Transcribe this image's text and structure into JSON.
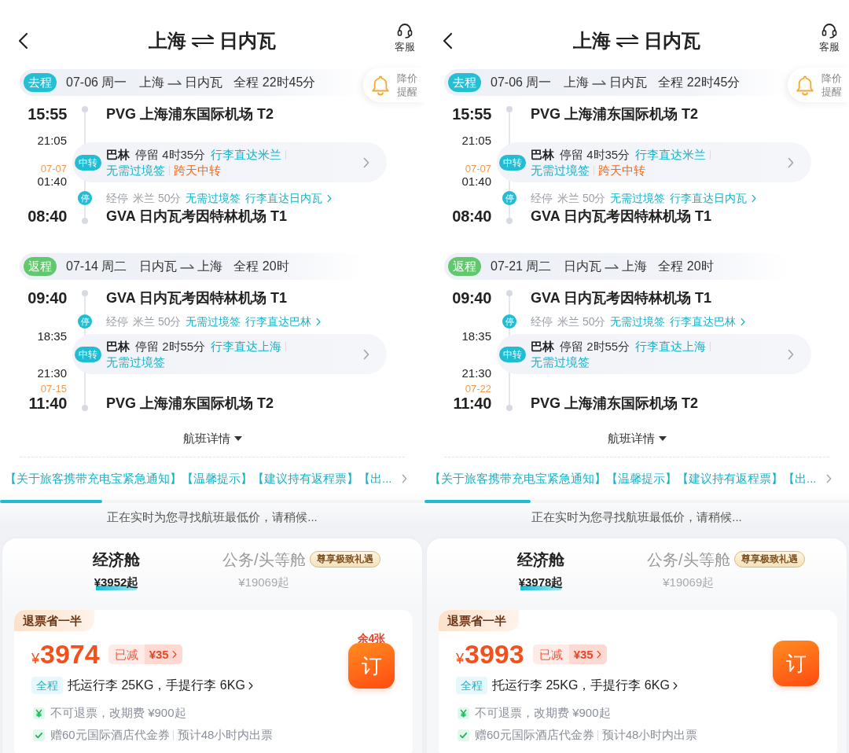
{
  "panels": [
    {
      "header": {
        "origin": "上海",
        "destination": "日内瓦",
        "service_label": "客服"
      },
      "legs": [
        {
          "kind": "outbound",
          "tag": "去程",
          "date": "07-06 周一",
          "from": "上海",
          "to": "日内瓦",
          "duration": "全程 22时45分",
          "price_alert": {
            "label": "降价提醒"
          },
          "stops": [
            {
              "kind": "airport",
              "time": "15:55",
              "airport": "PVG 上海浦东国际机场 T2"
            },
            {
              "kind": "transfer",
              "arrive": "21:05",
              "depart_date": "07-07",
              "depart": "01:40",
              "tag": "中转",
              "city": "巴林",
              "stay": "停留 4时35分",
              "notes": [
                {
                  "kind": "info",
                  "text": "行李直达米兰"
                },
                {
                  "kind": "info",
                  "text": "无需过境签"
                },
                {
                  "kind": "warning",
                  "text": "跨天中转"
                }
              ]
            },
            {
              "kind": "stopover",
              "tag": "停",
              "label": "经停",
              "detail": "米兰 50分",
              "notes": [
                "无需过境签",
                "行李直达日内瓦"
              ]
            },
            {
              "kind": "airport",
              "time": "08:40",
              "airport": "GVA 日内瓦考因特林机场 T1"
            }
          ]
        },
        {
          "kind": "return",
          "tag": "返程",
          "date": "07-14 周二",
          "from": "日内瓦",
          "to": "上海",
          "duration": "全程 20时",
          "stops": [
            {
              "kind": "airport",
              "time": "09:40",
              "airport": "GVA 日内瓦考因特林机场 T1"
            },
            {
              "kind": "stopover",
              "tag": "停",
              "label": "经停",
              "detail": "米兰 50分",
              "notes": [
                "无需过境签",
                "行李直达巴林"
              ]
            },
            {
              "kind": "transfer",
              "arrive": "18:35",
              "depart": "21:30",
              "tag": "中转",
              "city": "巴林",
              "stay": "停留 2时55分",
              "notes": [
                {
                  "kind": "info",
                  "text": "行李直达上海"
                },
                {
                  "kind": "info",
                  "text": "无需过境签"
                }
              ]
            },
            {
              "kind": "airport",
              "date": "07-15",
              "time": "11:40",
              "airport": "PVG 上海浦东国际机场 T2"
            }
          ]
        }
      ],
      "flight_details": "航班详情",
      "notice": "【关于旅客携带充电宝紧急通知】【温馨提示】【建议持有返程票】【出...",
      "progress": {
        "level": 0.24
      },
      "loading_text": "正在实时为您寻找航班最低价，请稍候...",
      "cabins": [
        {
          "name": "经济舱",
          "price": "¥3952起",
          "selected": true
        },
        {
          "name": "公务/头等舱",
          "price": "¥19069起",
          "selected": false,
          "badge": "尊享极致礼遇"
        }
      ],
      "fare": {
        "badge": "退票省一半",
        "currency": "¥",
        "amount": "3974",
        "discount_label": "已减",
        "discount": "¥35",
        "remaining": "余4张",
        "book_label": "订",
        "scope": "全程",
        "baggage": "托运行李 25KG，手提行李 6KG",
        "policies": [
          {
            "kind": "fee",
            "texts": [
              "不可退票，改期费 ¥900起"
            ]
          },
          {
            "kind": "perk",
            "texts": [
              "赠60元国际酒店代金券",
              "预计48小时内出票"
            ]
          }
        ]
      }
    },
    {
      "header": {
        "origin": "上海",
        "destination": "日内瓦",
        "service_label": "客服"
      },
      "legs": [
        {
          "kind": "outbound",
          "tag": "去程",
          "date": "07-06 周一",
          "from": "上海",
          "to": "日内瓦",
          "duration": "全程 22时45分",
          "price_alert": {
            "label": "降价提醒"
          },
          "stops": [
            {
              "kind": "airport",
              "time": "15:55",
              "airport": "PVG 上海浦东国际机场 T2"
            },
            {
              "kind": "transfer",
              "arrive": "21:05",
              "depart_date": "07-07",
              "depart": "01:40",
              "tag": "中转",
              "city": "巴林",
              "stay": "停留 4时35分",
              "notes": [
                {
                  "kind": "info",
                  "text": "行李直达米兰"
                },
                {
                  "kind": "info",
                  "text": "无需过境签"
                },
                {
                  "kind": "warning",
                  "text": "跨天中转"
                }
              ]
            },
            {
              "kind": "stopover",
              "tag": "停",
              "label": "经停",
              "detail": "米兰 50分",
              "notes": [
                "无需过境签",
                "行李直达日内瓦"
              ]
            },
            {
              "kind": "airport",
              "time": "08:40",
              "airport": "GVA 日内瓦考因特林机场 T1"
            }
          ]
        },
        {
          "kind": "return",
          "tag": "返程",
          "date": "07-21 周二",
          "from": "日内瓦",
          "to": "上海",
          "duration": "全程 20时",
          "stops": [
            {
              "kind": "airport",
              "time": "09:40",
              "airport": "GVA 日内瓦考因特林机场 T1"
            },
            {
              "kind": "stopover",
              "tag": "停",
              "label": "经停",
              "detail": "米兰 50分",
              "notes": [
                "无需过境签",
                "行李直达巴林"
              ]
            },
            {
              "kind": "transfer",
              "arrive": "18:35",
              "depart": "21:30",
              "tag": "中转",
              "city": "巴林",
              "stay": "停留 2时55分",
              "notes": [
                {
                  "kind": "info",
                  "text": "行李直达上海"
                },
                {
                  "kind": "info",
                  "text": "无需过境签"
                }
              ]
            },
            {
              "kind": "airport",
              "date": "07-22",
              "time": "11:40",
              "airport": "PVG 上海浦东国际机场 T2"
            }
          ]
        }
      ],
      "flight_details": "航班详情",
      "notice": "【关于旅客携带充电宝紧急通知】【温馨提示】【建议持有返程票】【出...",
      "progress": {
        "level": 0.25
      },
      "loading_text": "正在实时为您寻找航班最低价，请稍候...",
      "cabins": [
        {
          "name": "经济舱",
          "price": "¥3978起",
          "selected": true
        },
        {
          "name": "公务/头等舱",
          "price": "¥19069起",
          "selected": false,
          "badge": "尊享极致礼遇"
        }
      ],
      "fare": {
        "badge": "退票省一半",
        "currency": "¥",
        "amount": "3993",
        "discount_label": "已减",
        "discount": "¥35",
        "book_label": "订",
        "scope": "全程",
        "baggage": "托运行李 25KG，手提行李 6KG",
        "policies": [
          {
            "kind": "fee",
            "texts": [
              "不可退票，改期费 ¥900起"
            ]
          },
          {
            "kind": "perk",
            "texts": [
              "赠60元国际酒店代金券",
              "预计48小时内出票"
            ]
          }
        ]
      }
    }
  ]
}
